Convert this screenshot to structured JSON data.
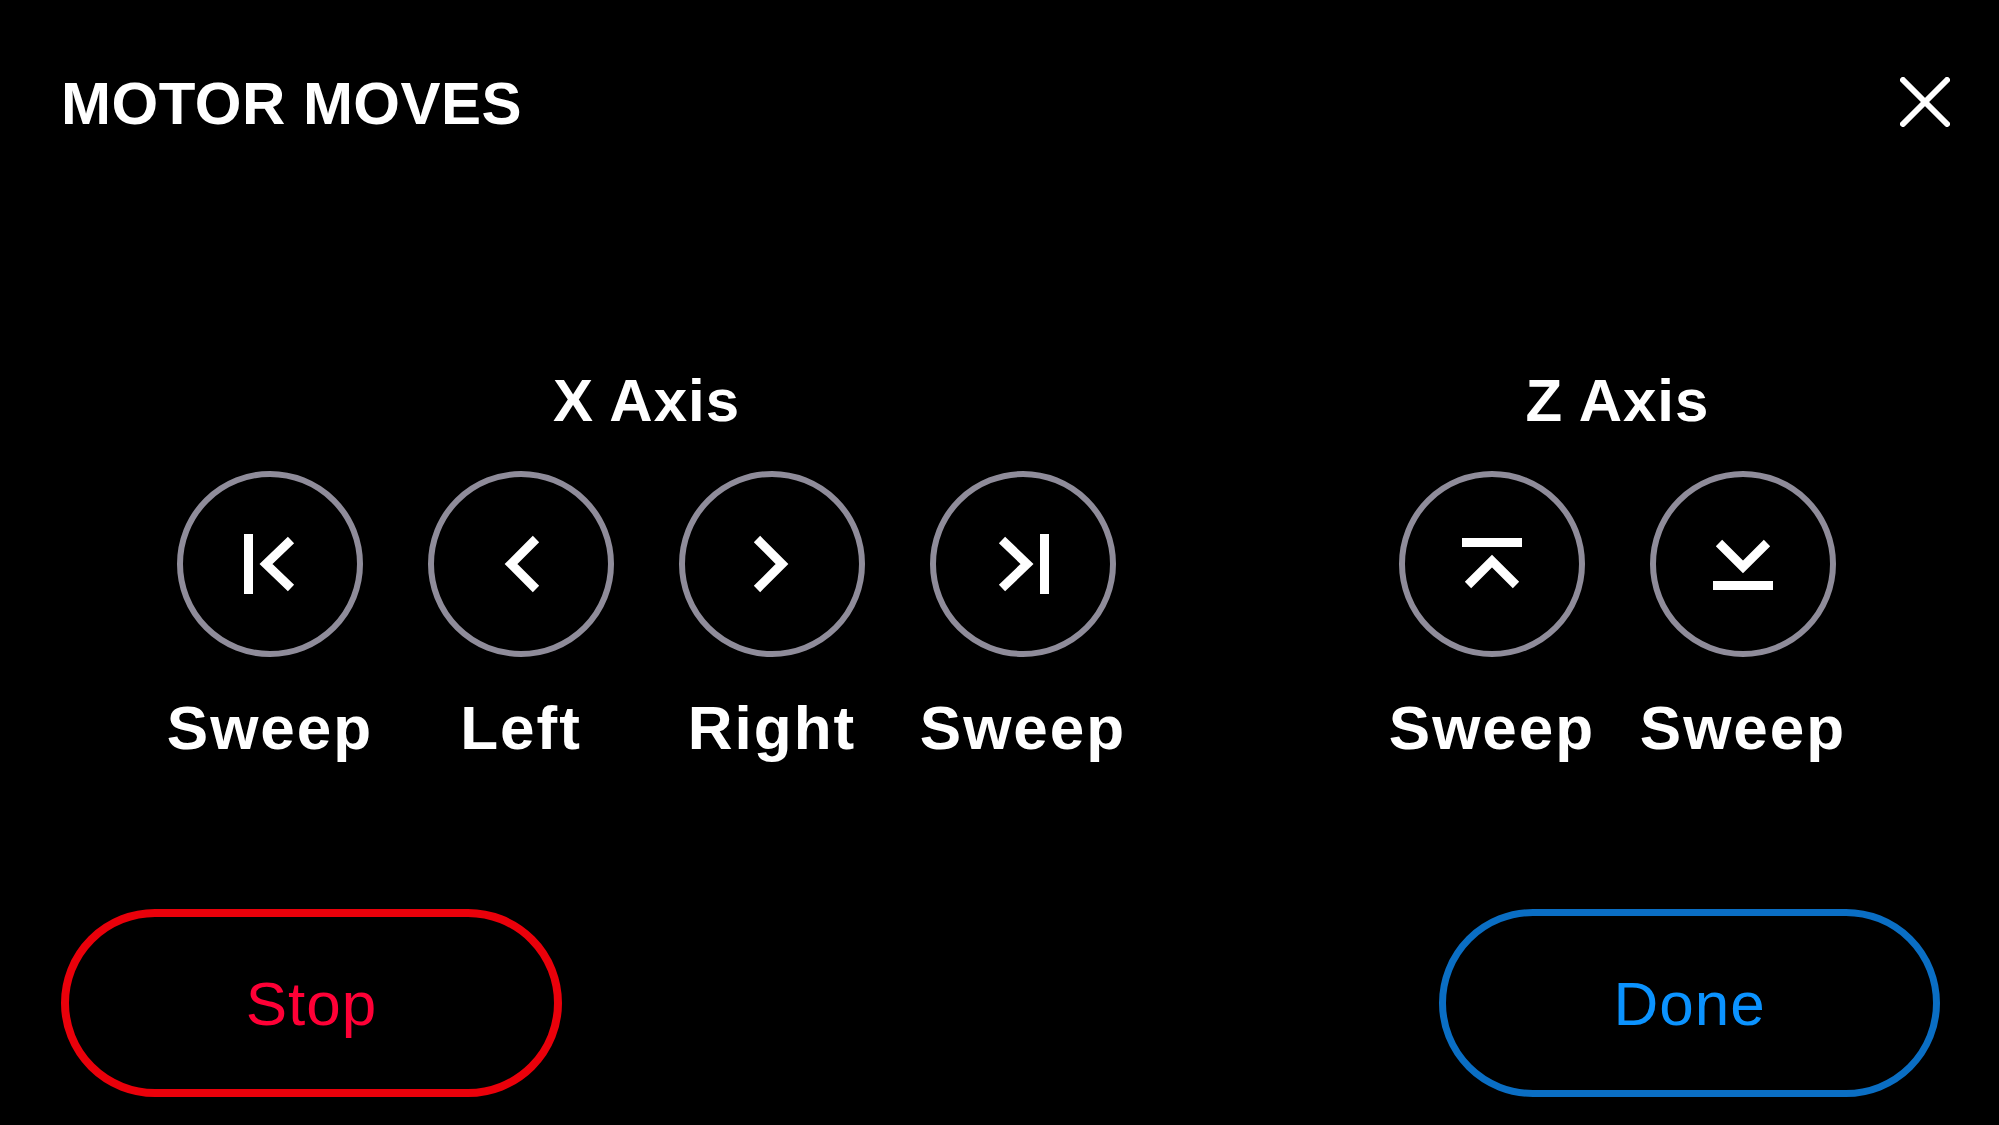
{
  "title": "MOTOR MOVES",
  "axes": [
    {
      "label": "X Axis",
      "moves": [
        {
          "kind": "start",
          "label": "Sweep"
        },
        {
          "kind": "left",
          "label": "Left"
        },
        {
          "kind": "right",
          "label": "Right"
        },
        {
          "kind": "end",
          "label": "Sweep"
        }
      ]
    },
    {
      "label": "Z Axis",
      "moves": [
        {
          "kind": "top",
          "label": "Sweep"
        },
        {
          "kind": "bottom",
          "label": "Sweep"
        }
      ]
    }
  ],
  "buttons": [
    {
      "kind": "danger",
      "label": "Stop"
    },
    {
      "kind": "primary",
      "label": "Done"
    }
  ]
}
